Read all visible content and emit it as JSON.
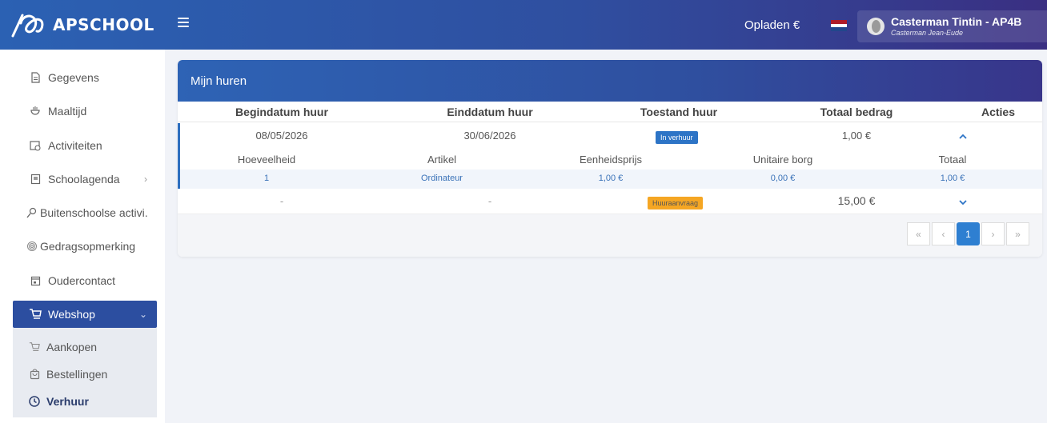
{
  "app": {
    "logo_text": "APSCHOOL"
  },
  "header": {
    "opladen": "Opladen €",
    "user_name": "Casterman Tintin - AP4B",
    "user_sub": "Casterman Jean-Eude",
    "flag_colors": [
      "#ae1c28",
      "#ffffff",
      "#21468b"
    ]
  },
  "sidebar": {
    "items": [
      {
        "label": "Gegevens",
        "icon": "document-icon"
      },
      {
        "label": "Maaltijd",
        "icon": "meal-icon"
      },
      {
        "label": "Activiteiten",
        "icon": "calendar-clock-icon"
      },
      {
        "label": "Schoolagenda",
        "icon": "agenda-icon"
      },
      {
        "label": "Buitenschoolse activi.",
        "icon": "person-search-icon"
      },
      {
        "label": "Gedragsopmerking",
        "icon": "fingerprint-icon"
      },
      {
        "label": "Oudercontact",
        "icon": "calendar-icon"
      },
      {
        "label": "Webshop",
        "icon": "cart-icon"
      }
    ],
    "submenu": [
      {
        "label": "Aankopen",
        "icon": "cart-icon"
      },
      {
        "label": "Bestellingen",
        "icon": "bag-icon"
      },
      {
        "label": "Verhuur",
        "icon": "clock-icon"
      }
    ]
  },
  "card": {
    "title": "Mijn huren",
    "columns": [
      "Begindatum huur",
      "Einddatum huur",
      "Toestand huur",
      "Totaal bedrag",
      "Acties"
    ],
    "rows": [
      {
        "begin": "08/05/2026",
        "end": "30/06/2026",
        "status": "In verhuur",
        "total": "1,00 €"
      },
      {
        "begin": "-",
        "end": "-",
        "status": "Huuraanvraag",
        "total": "15,00 €"
      }
    ],
    "sub_columns": [
      "Hoeveelheid",
      "Artikel",
      "Eenheidsprijs",
      "Unitaire borg",
      "Totaal"
    ],
    "sub_rows": [
      {
        "qty": "1",
        "article": "Ordinateur",
        "unit_price": "1,00 €",
        "deposit": "0,00 €",
        "total": "1,00 €"
      }
    ],
    "pagination": {
      "first": "«",
      "prev": "‹",
      "current": "1",
      "next": "›",
      "last": "»"
    }
  }
}
